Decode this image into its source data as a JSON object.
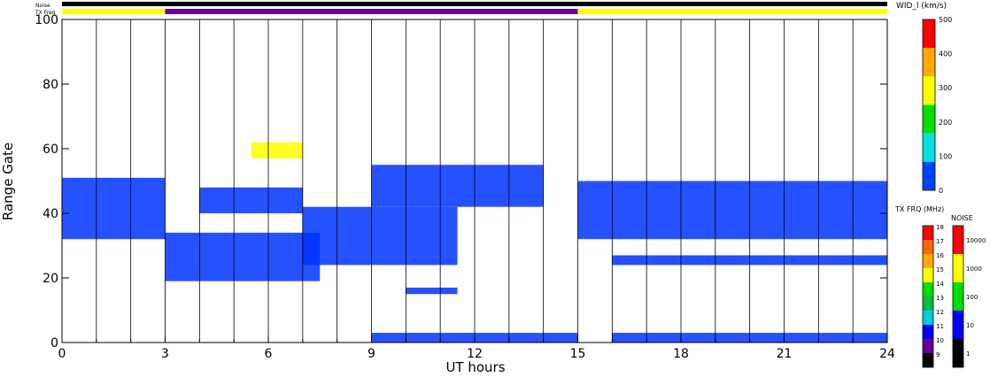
{
  "chart_data": [
    {
      "type": "heatmap",
      "title": "",
      "xlabel": "UT hours",
      "ylabel": "Range Gate",
      "xlim": [
        0,
        24
      ],
      "ylim": [
        0,
        100
      ],
      "x_ticks": [
        0,
        3,
        6,
        9,
        12,
        15,
        18,
        21,
        24
      ],
      "x_tick_labels": [
        "0",
        "3",
        "6",
        "9",
        "12",
        "15",
        "18",
        "21",
        "24"
      ],
      "y_ticks": [
        0,
        20,
        40,
        60,
        80,
        100
      ],
      "y_tick_labels": [
        "0",
        "20",
        "40",
        "60",
        "80",
        "100"
      ],
      "vertical_scan_lines_hours": [
        1,
        2,
        3,
        4,
        5,
        6,
        7,
        8,
        9,
        10,
        11,
        12,
        13,
        14,
        15,
        16,
        17,
        18,
        19,
        20,
        21,
        22,
        23
      ],
      "description_regions": [
        {
          "x": [
            0,
            3
          ],
          "y": [
            32,
            51
          ],
          "value": 40
        },
        {
          "x": [
            3,
            7.5
          ],
          "y": [
            19,
            34
          ],
          "value": 10
        },
        {
          "x": [
            7,
            11.5
          ],
          "y": [
            24,
            42
          ],
          "value": 30
        },
        {
          "x": [
            4,
            7
          ],
          "y": [
            40,
            48
          ],
          "value": 40
        },
        {
          "x": [
            5.5,
            7
          ],
          "y": [
            57,
            62
          ],
          "value": 300
        },
        {
          "x": [
            9,
            15
          ],
          "y": [
            0,
            3
          ],
          "value": 40
        },
        {
          "x": [
            16,
            24
          ],
          "y": [
            0,
            3
          ],
          "value": 40
        },
        {
          "x": [
            15,
            24
          ],
          "y": [
            32,
            50
          ],
          "value": 60
        },
        {
          "x": [
            9,
            14
          ],
          "y": [
            42,
            55
          ],
          "value": 60
        },
        {
          "x": [
            16,
            20
          ],
          "y": [
            24,
            27
          ],
          "value": 40
        },
        {
          "x": [
            20,
            24
          ],
          "y": [
            24,
            27
          ],
          "value": 40
        },
        {
          "x": [
            10,
            11.5
          ],
          "y": [
            15,
            17
          ],
          "value": 40
        }
      ]
    },
    {
      "type": "bar",
      "title": "Noise",
      "xlim": [
        0,
        24
      ],
      "segments": [
        {
          "x": [
            0,
            24
          ],
          "level": "black"
        }
      ]
    },
    {
      "type": "bar",
      "title": "TX Freq",
      "xlim": [
        0,
        24
      ],
      "segments": [
        {
          "x": [
            0,
            3
          ],
          "value": 15
        },
        {
          "x": [
            3,
            15
          ],
          "value": 10
        },
        {
          "x": [
            15,
            24
          ],
          "value": 15
        }
      ]
    }
  ],
  "side_labels": {
    "noise_label": "Noise",
    "txfreq_label": "TX Freq",
    "wid_title": "WID_l (km/s)",
    "txfrq_title": "TX FRQ (MHz)",
    "noise_title": "NOISE"
  },
  "colorbars": {
    "wid": {
      "labels": [
        "500",
        "400",
        "300",
        "200",
        "100",
        "0"
      ],
      "colors": [
        "#ff0000",
        "#ffaa00",
        "#ffff00",
        "#00dd00",
        "#00e0e0",
        "#0044ff"
      ]
    },
    "txfreq": {
      "labels": [
        "18",
        "17",
        "16",
        "15",
        "14",
        "13",
        "12",
        "11",
        "10",
        "9"
      ],
      "colors": [
        "#ff0000",
        "#ff6600",
        "#ffaa00",
        "#ffff00",
        "#00dd00",
        "#00bb44",
        "#00ccdd",
        "#0000ff",
        "#660099",
        "#000000"
      ]
    },
    "noise": {
      "labels": [
        "10000",
        "1000",
        "100",
        "10",
        "1"
      ],
      "colors": [
        "#ff0000",
        "#ffff00",
        "#00dd00",
        "#0000ff",
        "#000000"
      ]
    }
  }
}
